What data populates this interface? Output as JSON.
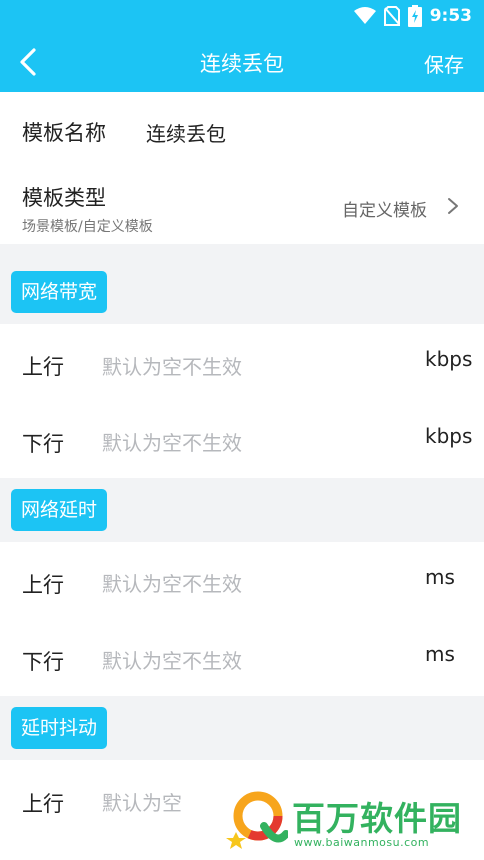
{
  "status_bar": {
    "time": "9:53",
    "icons": [
      "wifi-icon",
      "no-sim-icon",
      "battery-charging-icon"
    ]
  },
  "app_bar": {
    "title": "连续丢包",
    "back_icon": "chevron-left-icon",
    "save_label": "保存"
  },
  "template_name": {
    "label": "模板名称",
    "value": "连续丢包"
  },
  "template_type": {
    "label": "模板类型",
    "sublabel": "场景模板/自定义模板",
    "value": "自定义模板",
    "chevron_icon": "chevron-right-icon"
  },
  "sections": [
    {
      "title": "网络带宽",
      "rows": [
        {
          "label": "上行",
          "placeholder": "默认为空不生效",
          "unit": "kbps"
        },
        {
          "label": "下行",
          "placeholder": "默认为空不生效",
          "unit": "kbps"
        }
      ]
    },
    {
      "title": "网络延时",
      "rows": [
        {
          "label": "上行",
          "placeholder": "默认为空不生效",
          "unit": "ms"
        },
        {
          "label": "下行",
          "placeholder": "默认为空不生效",
          "unit": "ms"
        }
      ]
    },
    {
      "title": "延时抖动",
      "rows": [
        {
          "label": "上行",
          "placeholder": "默认为空",
          "unit": ""
        }
      ]
    }
  ],
  "watermark": {
    "text": "百万软件园",
    "url": "www.baiwanmosu.com"
  },
  "colors": {
    "accent": "#1cc4f4",
    "placeholder": "#b6b8bc",
    "watermark": "#33b25f"
  }
}
